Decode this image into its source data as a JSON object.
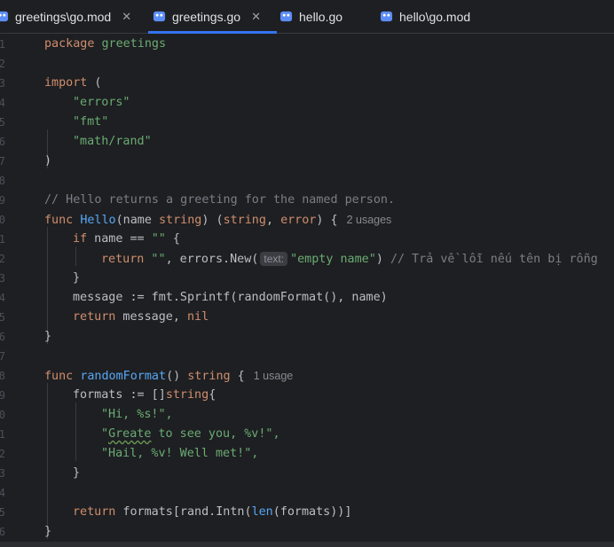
{
  "tabs": [
    {
      "label": "greetings\\go.mod",
      "icon": "go-mod-icon",
      "active": false,
      "closable": true
    },
    {
      "label": "greetings.go",
      "icon": "go-file-icon",
      "active": true,
      "closable": true
    },
    {
      "label": "hello.go",
      "icon": "go-file-icon",
      "active": false,
      "closable": false
    },
    {
      "label": "hello\\go.mod",
      "icon": "go-mod-icon",
      "active": false,
      "closable": false
    }
  ],
  "close_glyph": "✕",
  "line_numbers": [
    "1",
    "2",
    "3",
    "4",
    "5",
    "6",
    "7",
    "8",
    "9",
    "10",
    "11",
    "12",
    "13",
    "14",
    "15",
    "16",
    "17",
    "18",
    "19",
    "20",
    "21",
    "22",
    "23",
    "24",
    "25",
    "26"
  ],
  "code": {
    "l1_kw": "package",
    "l1_name": " greetings",
    "l3_kw": "import",
    "l3_rest": " (",
    "l4": "\"errors\"",
    "l5": "\"fmt\"",
    "l6": "\"math/rand\"",
    "l7": ")",
    "l9": "// Hello returns a greeting for the named person.",
    "l10_kw": "func",
    "l10_fn": "Hello",
    "l10_a": "(name ",
    "l10_t1": "string",
    "l10_b": ") (",
    "l10_t2": "string",
    "l10_c": ", ",
    "l10_t3": "error",
    "l10_d": ") {",
    "l10_usage": "2 usages",
    "l11_kw": "if",
    "l11_a": " name == ",
    "l11_str": "\"\"",
    "l11_b": " {",
    "l12_kw": "return",
    "l12_str": " \"\"",
    "l12_a": ", errors.New(",
    "l12_hint": "text:",
    "l12_arg": "\"empty name\"",
    "l12_b": ") ",
    "l12_cmt": "// Trả về lỗi nếu tên bị rỗng",
    "l13": "}",
    "l14_a": "message := fmt.Sprintf(randomFormat(), name)",
    "l15_kw": "return",
    "l15_a": " message, ",
    "l15_nil": "nil",
    "l16": "}",
    "l18_kw": "func",
    "l18_fn": "randomFormat",
    "l18_a": "() ",
    "l18_t": "string",
    "l18_b": " {",
    "l18_usage": "1 usage",
    "l19_a": "formats := []",
    "l19_t": "string",
    "l19_b": "{",
    "l20": "\"Hi, %s!\",",
    "l21_q": "\"",
    "l21_sq": "Greate",
    "l21_rest": " to see you, %v!\",",
    "l22": "\"Hail, %v! Well met!\",",
    "l23": "}",
    "l25_kw": "return",
    "l25_a": " formats[rand.Intn(",
    "l25_len": "len",
    "l25_b": "(formats))]",
    "l26": "}"
  },
  "colors": {
    "keyword": "#cf8e6d",
    "string": "#6aab73",
    "function": "#56a8f5",
    "comment": "#7a7e85",
    "accent": "#3574f0"
  }
}
